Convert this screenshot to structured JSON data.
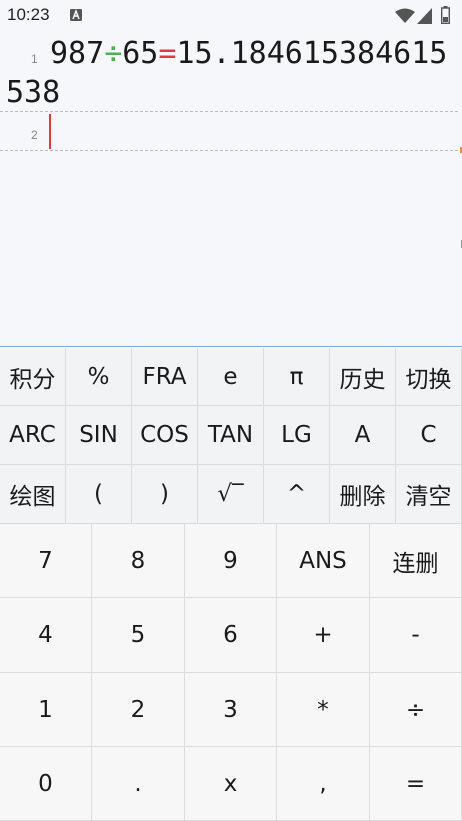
{
  "status_bar": {
    "time": "10:23",
    "icons": [
      "a-icon",
      "wifi-icon",
      "signal-icon",
      "battery-icon"
    ]
  },
  "display": {
    "lines": [
      {
        "number": "1",
        "operand1": "987",
        "operator": "÷",
        "operand2": "65",
        "equals": "=",
        "result": "15.184615384615538"
      },
      {
        "number": "2",
        "text": ""
      }
    ]
  },
  "keypad": {
    "function_rows": [
      [
        "积分",
        "%",
        "FRA",
        "e",
        "π",
        "历史",
        "切换"
      ],
      [
        "ARC",
        "SIN",
        "COS",
        "TAN",
        "LG",
        "A",
        "C"
      ],
      [
        "绘图",
        "(",
        ")",
        "√‾",
        "^",
        "删除",
        "清空"
      ]
    ],
    "number_rows": [
      [
        "7",
        "8",
        "9",
        "ANS",
        "连删"
      ],
      [
        "4",
        "5",
        "6",
        "+",
        "-"
      ],
      [
        "1",
        "2",
        "3",
        "*",
        "÷"
      ],
      [
        "0",
        ".",
        "x",
        ",",
        "="
      ]
    ]
  },
  "colors": {
    "operator": "#4caf50",
    "equals": "#e53935",
    "cursor": "#e53935",
    "display_background": "#f5f7fb",
    "keypad_background": "#f2f3f5"
  }
}
